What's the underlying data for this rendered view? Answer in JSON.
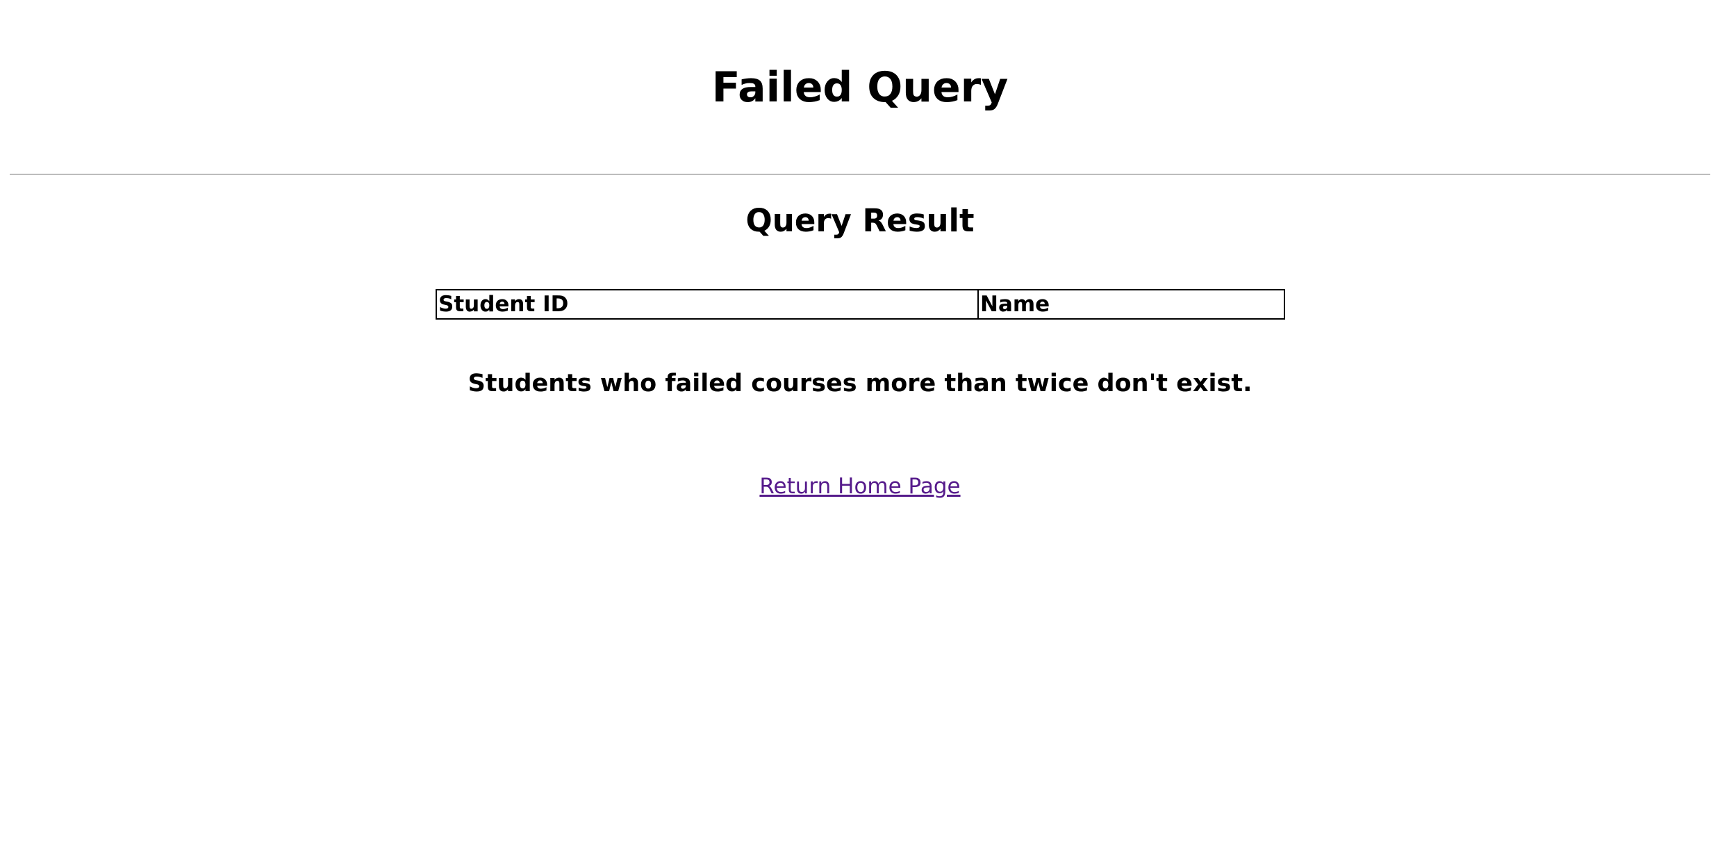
{
  "page": {
    "title": "Failed Query",
    "section_title": "Query Result"
  },
  "table": {
    "headers": [
      "Student ID",
      "Name"
    ],
    "rows": []
  },
  "message": "Students who failed courses more than twice don't exist.",
  "link": {
    "label": "Return Home Page",
    "color": "#551a8b"
  }
}
